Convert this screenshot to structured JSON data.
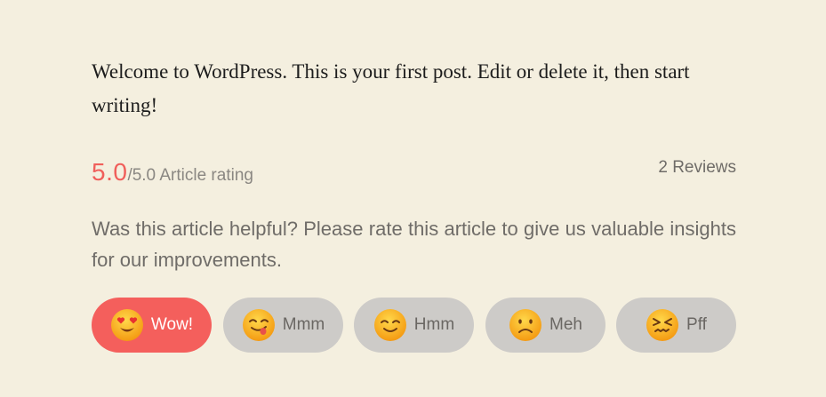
{
  "post": {
    "body": "Welcome to WordPress. This is your first post. Edit or delete it, then start writing!"
  },
  "rating": {
    "score": "5.0",
    "suffix": "/5.0 Article rating",
    "reviews": "2 Reviews"
  },
  "prompt": "Was this article helpful? Please rate this article to give us valuable insights for our improvements.",
  "reactions": [
    {
      "label": "Wow!",
      "icon": "heart-eyes-emoji-icon",
      "selected": true
    },
    {
      "label": "Mmm",
      "icon": "yum-emoji-icon",
      "selected": false
    },
    {
      "label": "Hmm",
      "icon": "smile-emoji-icon",
      "selected": false
    },
    {
      "label": "Meh",
      "icon": "frown-emoji-icon",
      "selected": false
    },
    {
      "label": "Pff",
      "icon": "angry-emoji-icon",
      "selected": false
    }
  ],
  "colors": {
    "background": "#f4efdf",
    "accent": "#f45f5c",
    "button": "#cdcbc8",
    "emoji": "#f8b21a"
  }
}
